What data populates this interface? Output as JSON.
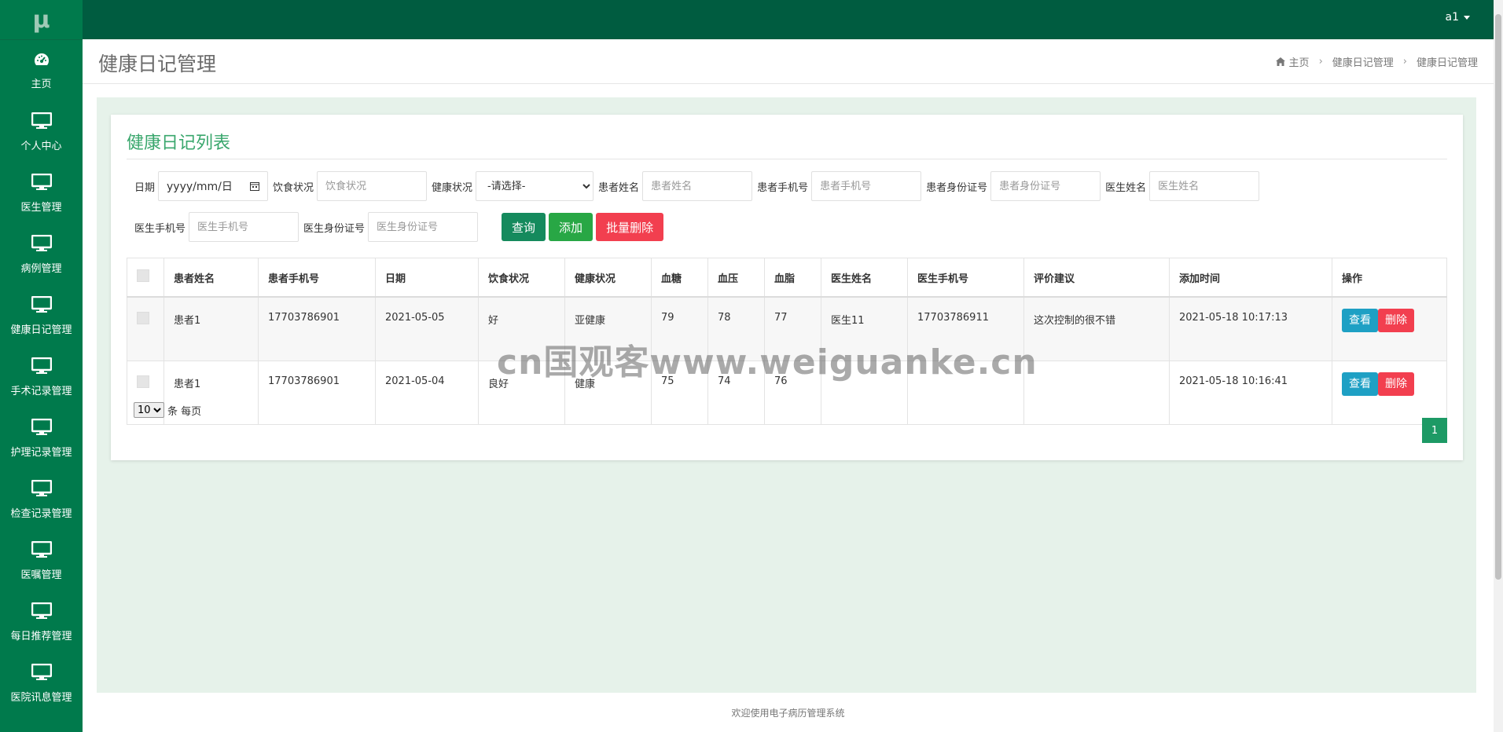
{
  "sidebar": {
    "logo": "μ",
    "items": [
      {
        "label": "主页",
        "icon": "dashboard-icon"
      },
      {
        "label": "个人中心",
        "icon": "monitor-icon"
      },
      {
        "label": "医生管理",
        "icon": "monitor-icon"
      },
      {
        "label": "病例管理",
        "icon": "monitor-icon"
      },
      {
        "label": "健康日记管理",
        "icon": "monitor-icon"
      },
      {
        "label": "手术记录管理",
        "icon": "monitor-icon"
      },
      {
        "label": "护理记录管理",
        "icon": "monitor-icon"
      },
      {
        "label": "检查记录管理",
        "icon": "monitor-icon"
      },
      {
        "label": "医嘱管理",
        "icon": "monitor-icon"
      },
      {
        "label": "每日推荐管理",
        "icon": "monitor-icon"
      },
      {
        "label": "医院讯息管理",
        "icon": "monitor-icon"
      }
    ]
  },
  "topbar": {
    "user": "a1"
  },
  "header": {
    "title": "健康日记管理",
    "breadcrumb": [
      "主页",
      "健康日记管理",
      "健康日记管理"
    ]
  },
  "card": {
    "title": "健康日记列表",
    "filters": {
      "date_label": "日期",
      "date_placeholder": "yyyy/mm/日",
      "diet_label": "饮食状况",
      "diet_placeholder": "饮食状况",
      "health_label": "健康状况",
      "health_selected": "-请选择-",
      "patient_name_label": "患者姓名",
      "patient_name_placeholder": "患者姓名",
      "patient_phone_label": "患者手机号",
      "patient_phone_placeholder": "患者手机号",
      "patient_id_label": "患者身份证号",
      "patient_id_placeholder": "患者身份证号",
      "doctor_name_label": "医生姓名",
      "doctor_name_placeholder": "医生姓名",
      "doctor_phone_label": "医生手机号",
      "doctor_phone_placeholder": "医生手机号",
      "doctor_id_label": "医生身份证号",
      "doctor_id_placeholder": "医生身份证号"
    },
    "buttons": {
      "query": "查询",
      "add": "添加",
      "batch_delete": "批量删除"
    },
    "table": {
      "headers": [
        "患者姓名",
        "患者手机号",
        "日期",
        "饮食状况",
        "健康状况",
        "血糖",
        "血压",
        "血脂",
        "医生姓名",
        "医生手机号",
        "评价建议",
        "添加时间",
        "操作"
      ],
      "rows": [
        [
          "患者1",
          "17703786901",
          "2021-05-05",
          "好",
          "亚健康",
          "79",
          "78",
          "77",
          "医生11",
          "17703786911",
          "这次控制的很不错",
          "2021-05-18 10:17:13"
        ],
        [
          "患者1",
          "17703786901",
          "2021-05-04",
          "良好",
          "健康",
          "75",
          "74",
          "76",
          "",
          "",
          "",
          "2021-05-18 10:16:41"
        ]
      ],
      "view_label": "查看",
      "delete_label": "删除"
    },
    "page_size": {
      "selected": "10",
      "suffix": "条 每页"
    },
    "current_page": "1"
  },
  "watermark": "cn国观客www.weiguanke.cn",
  "footer": "欢迎使用电子病历管理系统",
  "colors": {
    "sidebar": "#007a4c",
    "topbar": "#005c40",
    "accent": "#3aa76d",
    "danger": "#f23f4f",
    "info": "#1ea0c4"
  }
}
